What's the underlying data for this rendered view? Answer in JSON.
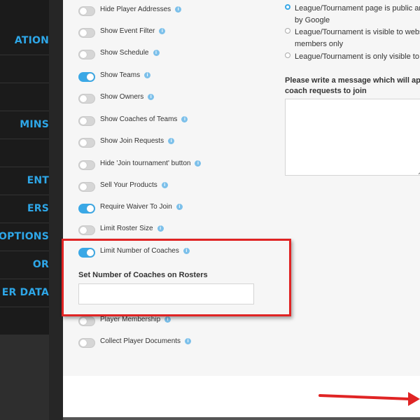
{
  "sidebar": {
    "items": [
      {
        "label": "ATION"
      },
      {
        "label": ""
      },
      {
        "label": ""
      },
      {
        "label": "MINS"
      },
      {
        "label": ""
      },
      {
        "label": "ENT"
      },
      {
        "label": "ERS"
      },
      {
        "label": "OPTIONS"
      },
      {
        "label": "OR"
      },
      {
        "label": "ER DATA"
      }
    ]
  },
  "settings": [
    {
      "label": "Hide Player Addresses",
      "on": false
    },
    {
      "label": "Show Event Filter",
      "on": false
    },
    {
      "label": "Show Schedule",
      "on": false
    },
    {
      "label": "Show Teams",
      "on": true
    },
    {
      "label": "Show Owners",
      "on": false
    },
    {
      "label": "Show Coaches of Teams",
      "on": false
    },
    {
      "label": "Show Join Requests",
      "on": false
    },
    {
      "label": "Hide 'Join tournament' button",
      "on": false
    },
    {
      "label": "Sell Your Products",
      "on": false
    },
    {
      "label": "Require Waiver To Join",
      "on": true
    },
    {
      "label": "Limit Roster Size",
      "on": false
    },
    {
      "label": "Limit Number of Coaches",
      "on": true
    },
    {
      "label": "Player Membership",
      "on": false
    },
    {
      "label": "Collect Player Documents",
      "on": false
    }
  ],
  "coaches": {
    "heading": "Set Number of Coaches on Rosters",
    "value": ""
  },
  "visibility": {
    "options": [
      {
        "line1": "League/Tournament page is public an",
        "line2": "by Google",
        "checked": true
      },
      {
        "line1": "League/Tournament is visible to webs",
        "line2": "members only",
        "checked": false
      },
      {
        "line1": "League/Tournament is only visible to",
        "line2": "",
        "checked": false
      }
    ]
  },
  "message": {
    "heading_line1": "Please write a message which will appe",
    "heading_line2": "coach requests to join",
    "value": ""
  },
  "colors": {
    "accent": "#3aa8e6",
    "highlight": "#e02424"
  }
}
